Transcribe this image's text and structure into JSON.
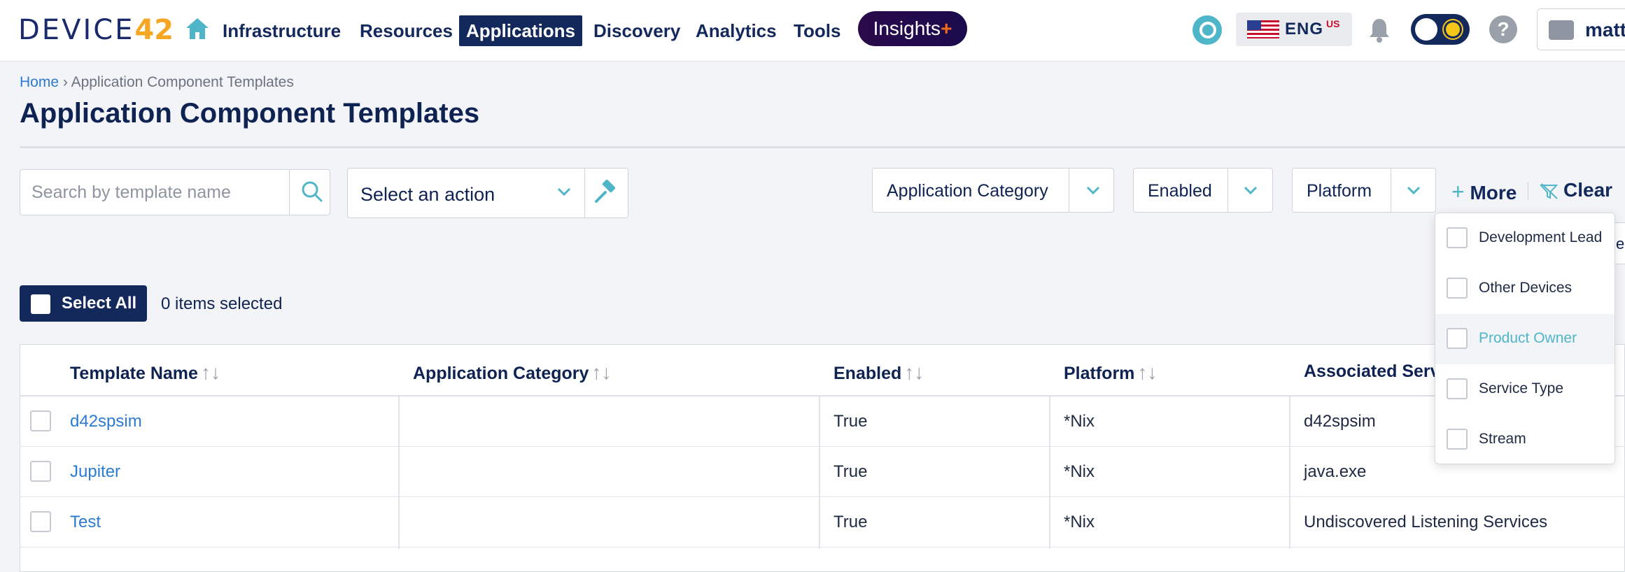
{
  "nav": {
    "logo_text": "DEVICE",
    "logo_num": "42",
    "items": [
      "Infrastructure",
      "Resources",
      "Applications",
      "Discovery",
      "Analytics",
      "Tools"
    ],
    "insights_label": "Insights",
    "insights_plus": "+",
    "lang_code": "ENG",
    "lang_region": "US",
    "help_glyph": "?",
    "user_name": "matt"
  },
  "breadcrumb": {
    "home": "Home",
    "separator": "›",
    "current": "Application Component Templates"
  },
  "page_title": "Application Component Templates",
  "toolbar": {
    "search_placeholder": "Search by template name",
    "action_label": "Select an action",
    "filters": [
      "Application Category",
      "Enabled",
      "Platform"
    ],
    "more_plus": "+",
    "more_label": "More",
    "clear_label": "Clear"
  },
  "more_dropdown": {
    "options": [
      "Development Lead",
      "Other Devices",
      "Product Owner",
      "Service Type",
      "Stream"
    ],
    "hovered": "Product Owner",
    "peek_text": "ec"
  },
  "selection": {
    "select_all_label": "Select All",
    "count_text": "0 items selected"
  },
  "table": {
    "sort_glyph": "↑↓",
    "columns": [
      "Template Name",
      "Application Category",
      "Enabled",
      "Platform",
      "Associated Servi"
    ],
    "rows": [
      {
        "name": "d42spsim",
        "category": "",
        "enabled": "True",
        "platform": "*Nix",
        "service": "d42spsim"
      },
      {
        "name": "Jupiter",
        "category": "",
        "enabled": "True",
        "platform": "*Nix",
        "service": "java.exe"
      },
      {
        "name": "Test",
        "category": "",
        "enabled": "True",
        "platform": "*Nix",
        "service": "Undiscovered Listening Services"
      }
    ]
  },
  "colors": {
    "brand_navy": "#13295c",
    "accent_teal": "#4fb6c9",
    "link_blue": "#2a7bd1",
    "logo_orange": "#f5a623"
  }
}
